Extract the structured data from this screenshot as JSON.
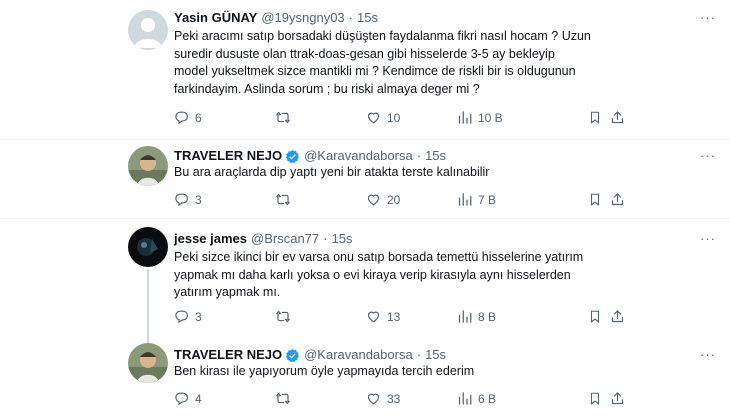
{
  "colors": {
    "text": "#0f1419",
    "muted": "#536471",
    "verified": "#1d9bf0",
    "divider": "#eff3f4"
  },
  "icons": [
    "reply-icon",
    "retweet-icon",
    "like-icon",
    "views-icon",
    "bookmark-icon",
    "share-icon",
    "more-icon",
    "verified-badge-icon"
  ],
  "tweets": [
    {
      "name": "Yasin GÜNAY",
      "handle": "@19ysngny03",
      "time": "15s",
      "text": "Peki aracımı satıp borsadaki düşüşten faydalanma fikri nasıl hocam ? Uzun\nsuredir dususte olan ttrak-doas-gesan gibi hisselerde 3-5 ay bekleyip\nmodel yukseltmek sizce mantikli mi ?   Kendimce de riskli bir is oldugunun\nfarkindayim. Aslinda sorum ; bu riski almaya deger mi ?",
      "replies": "6",
      "retweets": "",
      "likes": "10",
      "views": "10 B"
    },
    {
      "name": "TRAVELER NEJO",
      "handle": "@Karavandaborsa",
      "time": "15s",
      "text": "Bu ara araçlarda dip yaptı yeni bir atakta terste kalınabilir",
      "replies": "3",
      "retweets": "",
      "likes": "20",
      "views": "7 B"
    },
    {
      "name": "jesse james",
      "handle": "@Brscan77",
      "time": "15s",
      "text": "Peki sizce ikinci bir ev varsa onu satıp borsada temettü hisselerine yatırım\nyapmak mı daha karlı yoksa o evi kiraya verip kirasıyla aynı hisselerden\nyatırım yapmak mı.",
      "replies": "3",
      "retweets": "",
      "likes": "13",
      "views": "8 B"
    },
    {
      "name": "TRAVELER NEJO",
      "handle": "@Karavandaborsa",
      "time": "15s",
      "text": "Ben kirası ile yapıyorum öyle yapmayıda tercih ederim",
      "replies": "4",
      "retweets": "",
      "likes": "33",
      "views": "6 B"
    }
  ]
}
